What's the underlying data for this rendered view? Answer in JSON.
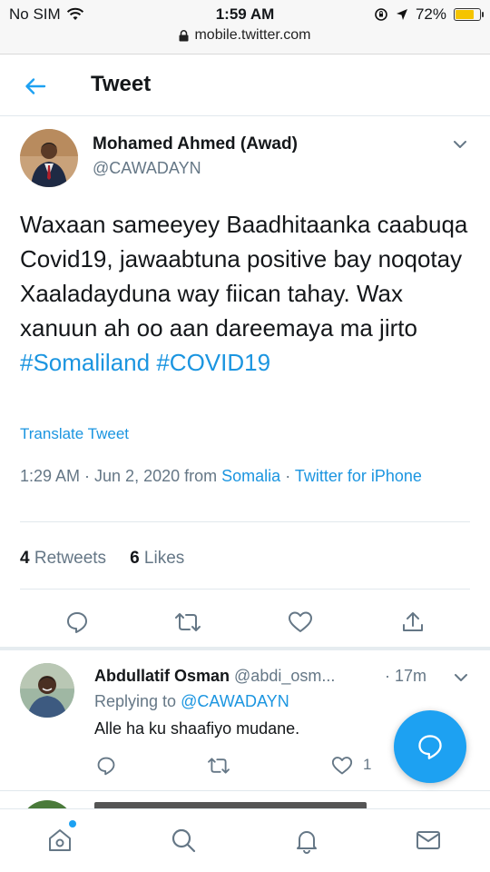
{
  "status_bar": {
    "carrier": "No SIM",
    "time": "1:59 AM",
    "battery": "72%",
    "battery_level": 0.72,
    "url": "mobile.twitter.com"
  },
  "header": {
    "title": "Tweet"
  },
  "tweet": {
    "author_name": "Mohamed Ahmed (Awad)",
    "author_handle": "@CAWADAYN",
    "text_plain": "Waxaan sameeyey Baadhitaanka caabuqa Covid19, jawaabtuna positive bay noqotay   Xaaladayduna way fiican tahay. Wax xanuun ah oo aan dareemaya ma jirto",
    "hashtag1": "#Somaliland",
    "hashtag2": "#COVID19",
    "translate_label": "Translate Tweet",
    "timestamp": "1:29 AM · Jun 2, 2020 from",
    "location": "Somalia",
    "separator": "·",
    "source": "Twitter for iPhone",
    "retweets_count": "4",
    "retweets_label": "Retweets",
    "likes_count": "6",
    "likes_label": "Likes"
  },
  "reply": {
    "name": "Abdullatif Osman",
    "handle": "@abdi_osm...",
    "time": "· 17m",
    "replying_prefix": "Replying to",
    "replying_to": "@CAWADAYN",
    "text": "Alle ha ku shaafiyo mudane.",
    "like_count": "1"
  },
  "colors": {
    "accent": "#1da1f2",
    "link": "#1b95e0",
    "muted": "#657786",
    "text": "#14171a"
  },
  "icons": {
    "back": "arrow-left-icon",
    "reply": "reply-icon",
    "retweet": "retweet-icon",
    "like": "heart-icon",
    "share": "share-icon",
    "compose": "compose-reply-icon",
    "home": "home-icon",
    "search": "search-icon",
    "notifications": "bell-icon",
    "messages": "mail-icon"
  }
}
